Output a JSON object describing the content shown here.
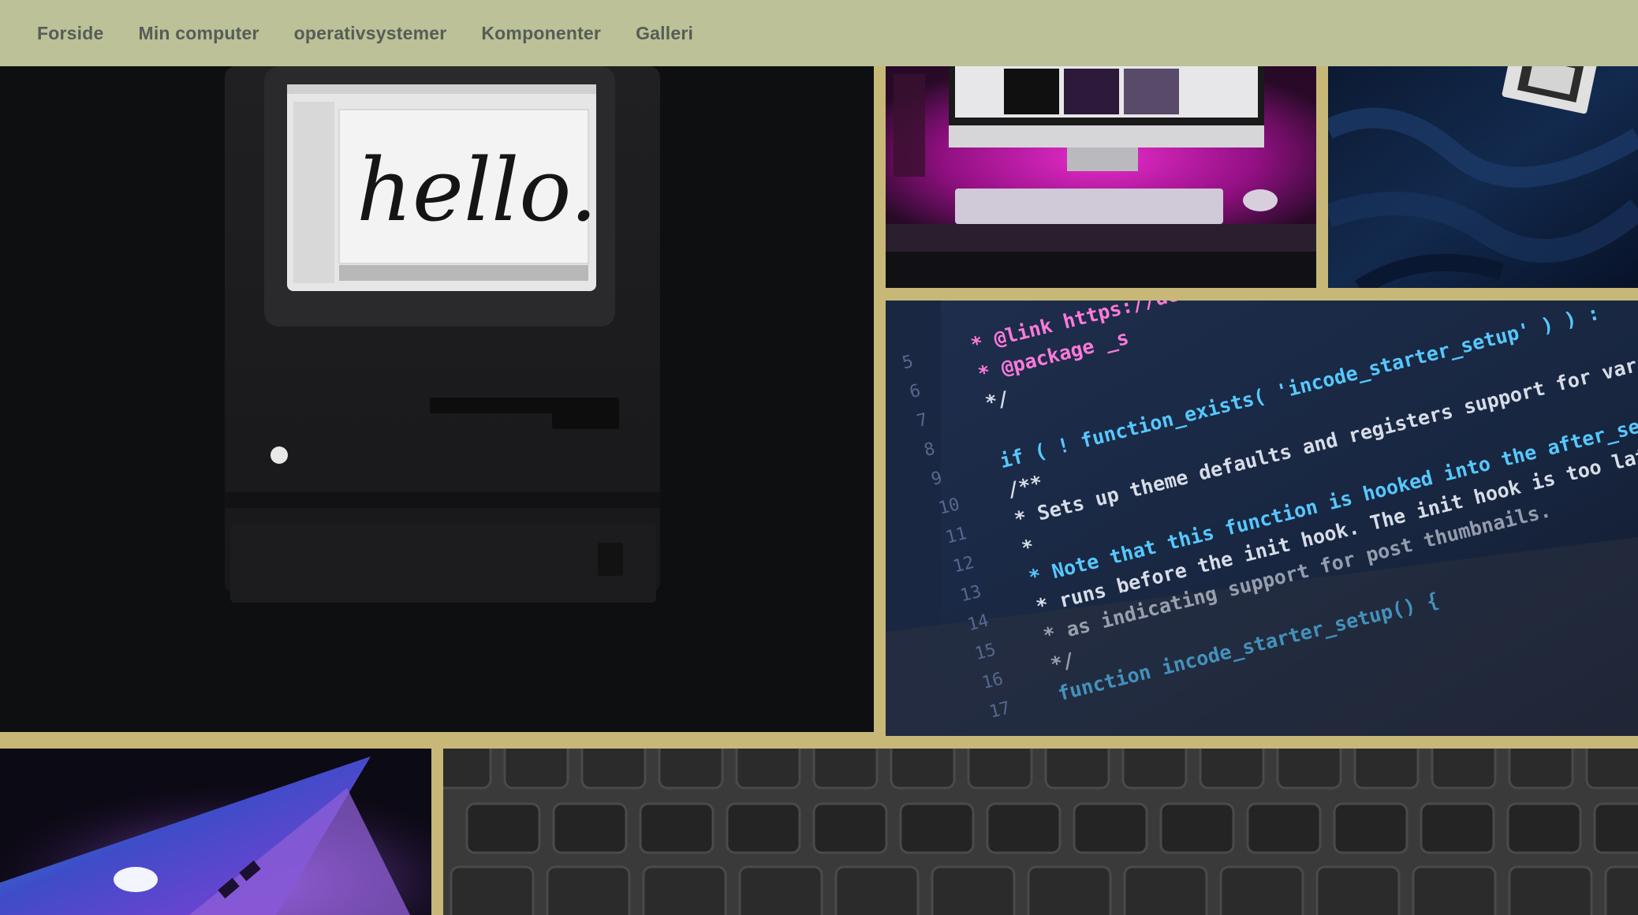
{
  "nav": {
    "items": [
      {
        "label": "Forside"
      },
      {
        "label": "Min computer"
      },
      {
        "label": "operativsystemer"
      },
      {
        "label": "Komponenter"
      },
      {
        "label": "Galleri"
      }
    ]
  },
  "gallery": {
    "mac_screen_text": "hello.",
    "code_lines": [
      {
        "num": "5",
        "text": "* @link https://deve"
      },
      {
        "num": "6",
        "text": "* @package _s"
      },
      {
        "num": "7",
        "text": "*/"
      },
      {
        "num": "8",
        "text": ""
      },
      {
        "num": "9",
        "text": "if ( ! function_exists( 'incode_starter_setup' ) ) :"
      },
      {
        "num": "10",
        "text": "/**"
      },
      {
        "num": "11",
        "text": "* Sets up theme defaults and registers support for various"
      },
      {
        "num": "12",
        "text": "*"
      },
      {
        "num": "13",
        "text": "* Note that this function is hooked into the after_setup_theme"
      },
      {
        "num": "14",
        "text": "* runs before the init hook. The init hook is too late for some"
      },
      {
        "num": "15",
        "text": "* as indicating support for post thumbnails."
      },
      {
        "num": "16",
        "text": "*/"
      },
      {
        "num": "17",
        "text": "function incode_starter_setup() {"
      }
    ]
  },
  "colors": {
    "nav_bg": "#bcc197",
    "page_bg": "#c7b878",
    "nav_text": "#555d57",
    "pink_glow": "#e020c0",
    "code_bg": "#1b2a44"
  }
}
